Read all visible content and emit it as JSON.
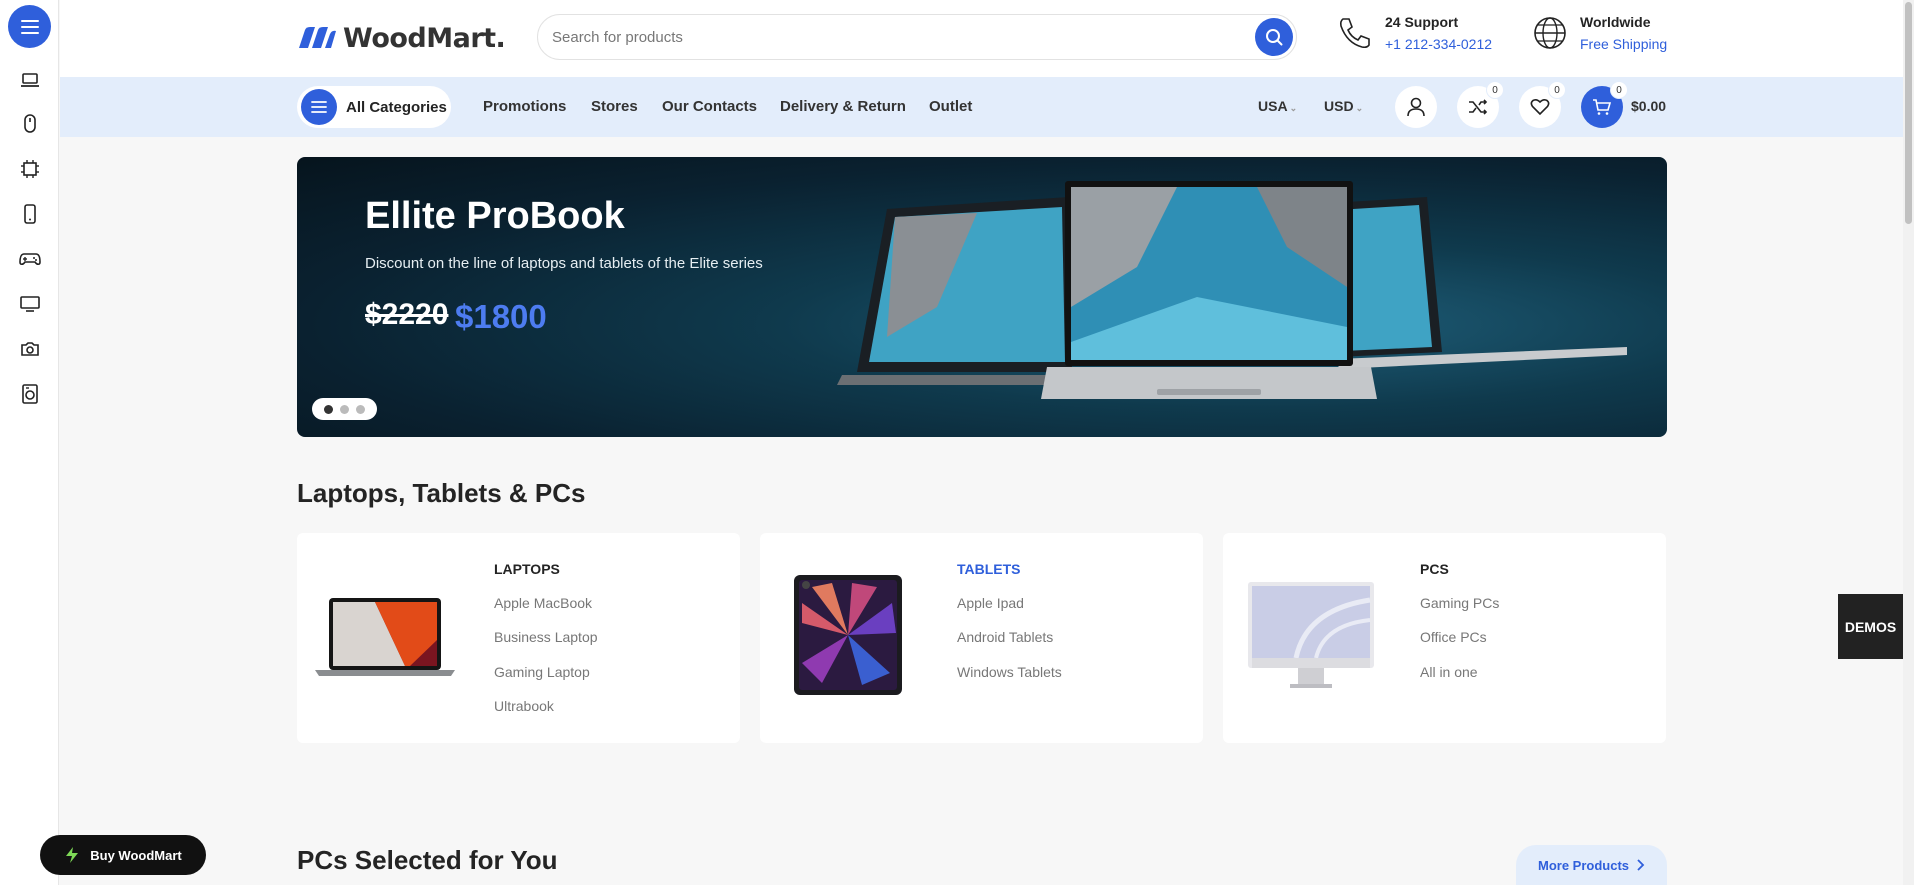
{
  "rail": {
    "icons": [
      "laptop-icon",
      "mouse-icon",
      "cpu-icon",
      "phone-icon",
      "gamepad-icon",
      "monitor-icon",
      "camera-icon",
      "washer-icon"
    ]
  },
  "header": {
    "logo_text": "WoodMart.",
    "search_placeholder": "Search for products",
    "support_title": "24 Support",
    "support_phone": "+1 212-334-0212",
    "shipping_title": "Worldwide",
    "shipping_sub": "Free Shipping"
  },
  "nav": {
    "all_categories": "All Categories",
    "links": [
      "Promotions",
      "Stores",
      "Our Contacts",
      "Delivery & Return",
      "Outlet"
    ],
    "country": "USA",
    "currency": "USD",
    "compare_count": "0",
    "wishlist_count": "0",
    "cart_count": "0",
    "cart_total": "$0.00"
  },
  "hero": {
    "title": "Ellite ProBook",
    "subtitle": "Discount on the line of laptops and tablets of the Elite series",
    "old_price": "$2220",
    "new_price": "$1800",
    "slides": 3,
    "active_slide": 1
  },
  "sections": {
    "categories_title": "Laptops, Tablets & PCs",
    "selected_title": "PCs Selected for You",
    "more_products": "More Products"
  },
  "cards": [
    {
      "title": "LAPTOPS",
      "items": [
        "Apple MacBook",
        "Business Laptop",
        "Gaming Laptop",
        "Ultrabook"
      ]
    },
    {
      "title": "TABLETS",
      "items": [
        "Apple Ipad",
        "Android Tablets",
        "Windows Tablets"
      ]
    },
    {
      "title": "PCS",
      "items": [
        "Gaming PCs",
        "Office PCs",
        "All in one"
      ]
    }
  ],
  "floating": {
    "buy_label": "Buy WoodMart",
    "demos_label": "DEMOS"
  },
  "colors": {
    "accent": "#2f5fdb",
    "nav_bg": "#e3edfb",
    "page_bg": "#f7f7f7"
  }
}
